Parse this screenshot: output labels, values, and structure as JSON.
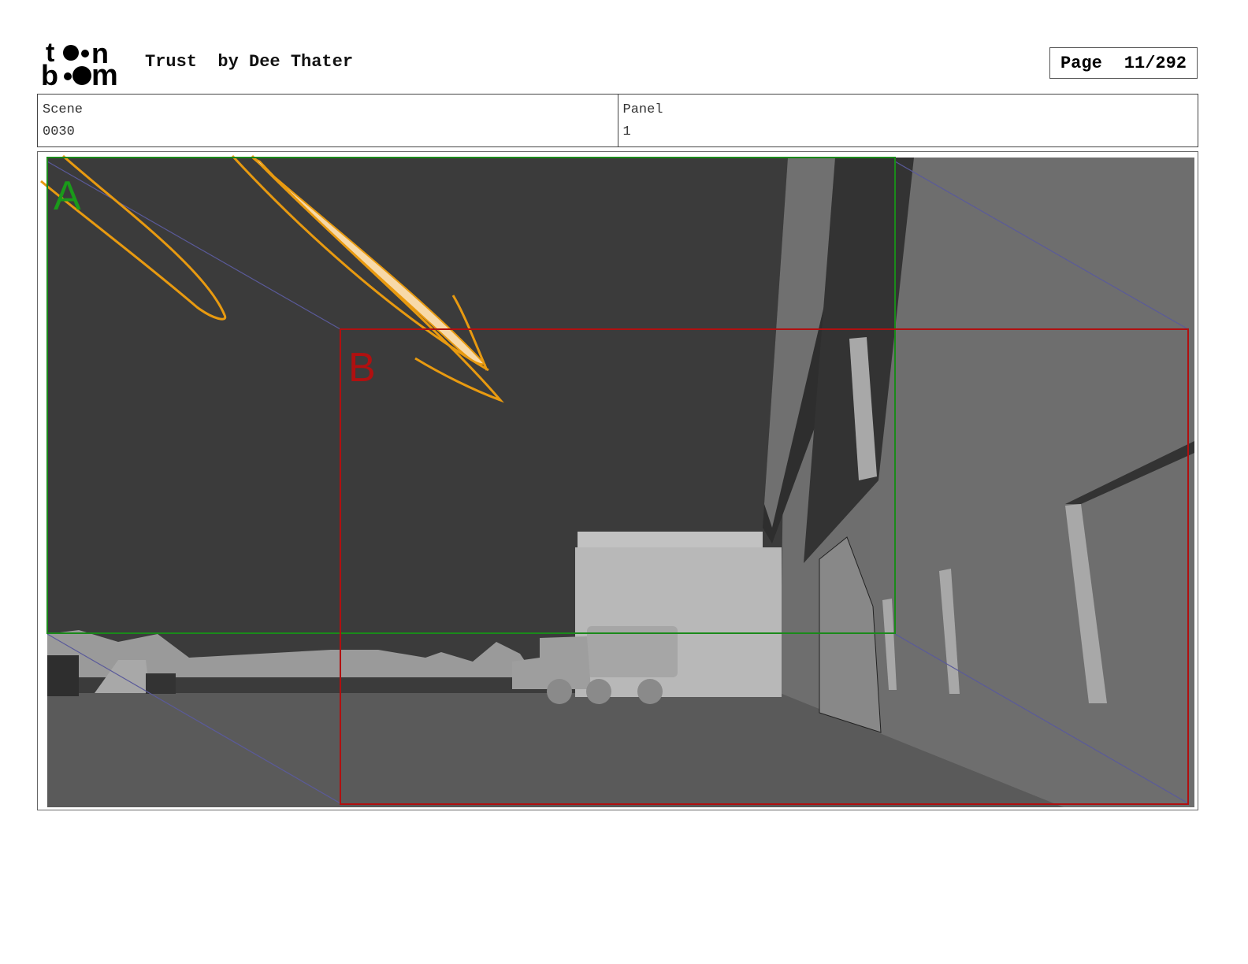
{
  "header": {
    "logo_text": "toon boom",
    "title": "Trust  by Dee Thater",
    "page_label": "Page",
    "page_value": "11/292"
  },
  "info": {
    "scene_label": "Scene",
    "scene_value": "0030",
    "panel_label": "Panel",
    "panel_value": "1"
  },
  "panel_image": {
    "frame_a_label": "A",
    "frame_b_label": "B",
    "frame_a_color": "#1a8a1a",
    "frame_b_color": "#b01010",
    "sketch_color": "#e89a10"
  }
}
